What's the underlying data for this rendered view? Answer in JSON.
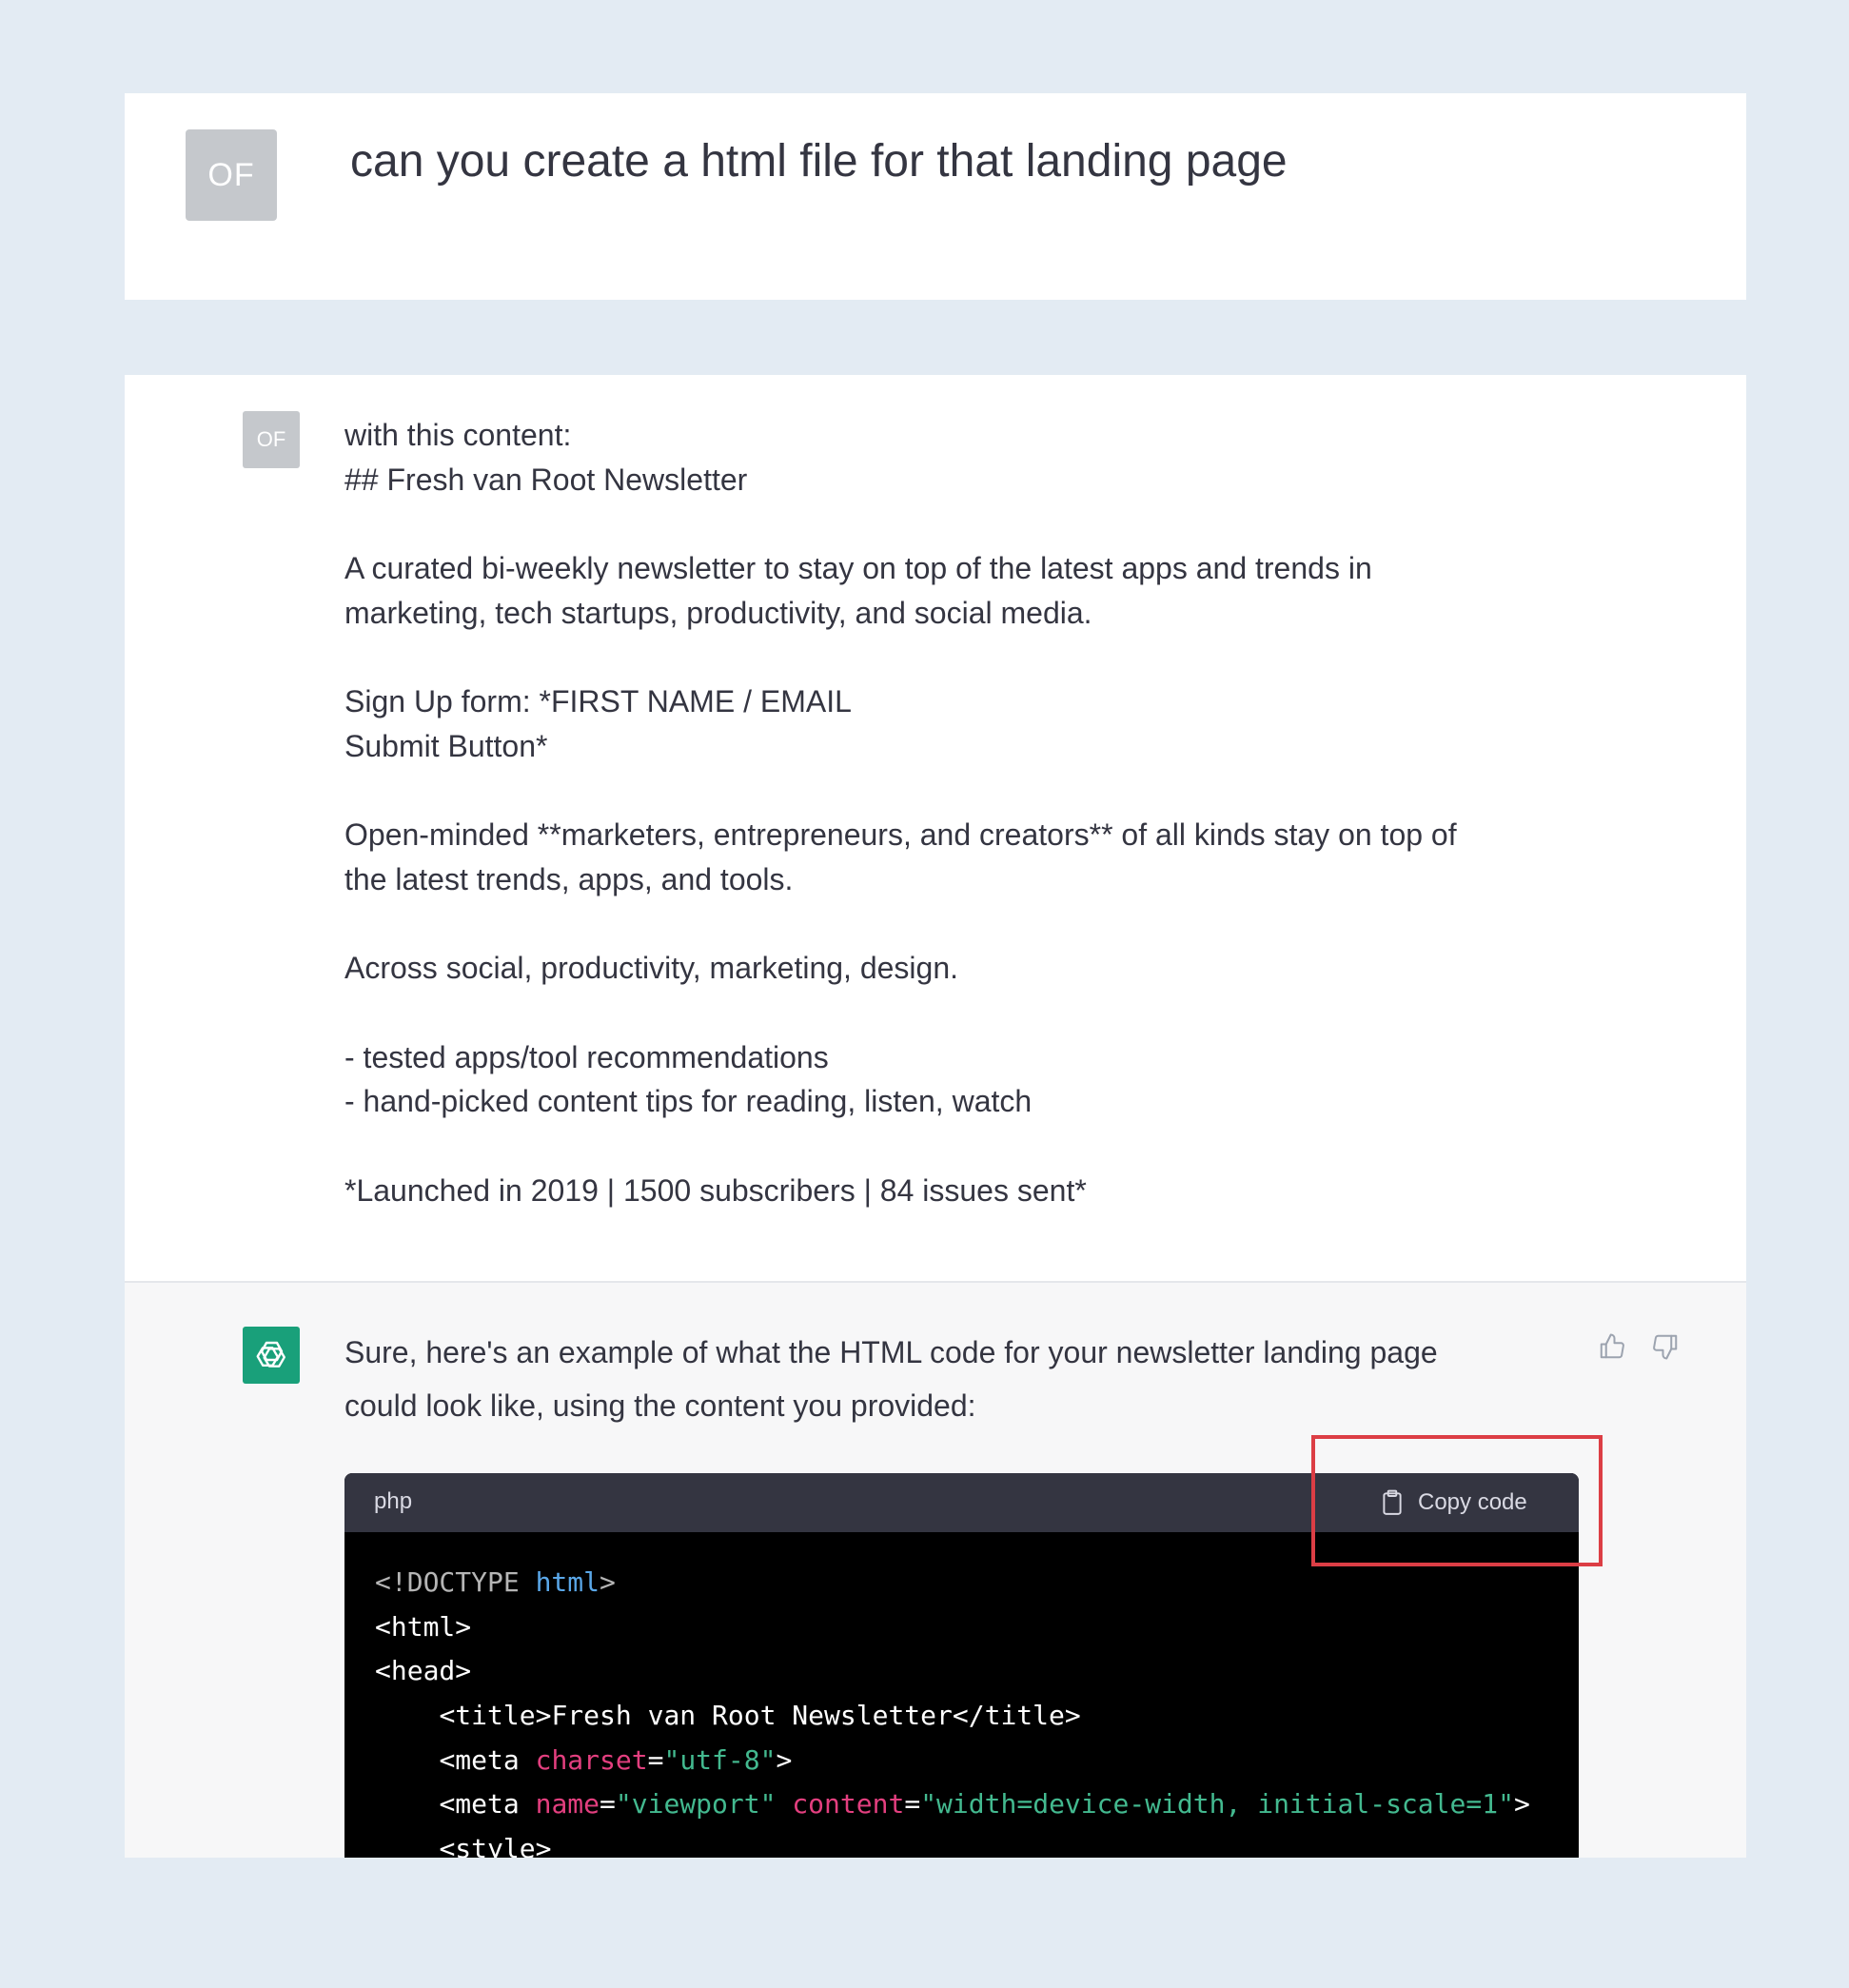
{
  "top_question": {
    "avatar": "OF",
    "text": "can you create a html file for that landing page"
  },
  "user_message": {
    "avatar": "OF",
    "lines": [
      "with this content:",
      "## Fresh van Root Newsletter",
      "",
      "A curated bi-weekly newsletter to stay on top of the latest apps and trends in",
      "marketing, tech startups, productivity, and social media.",
      "",
      "Sign Up form: *FIRST NAME / EMAIL",
      "Submit Button*",
      "",
      "Open-minded **marketers, entrepreneurs, and creators** of all kinds stay on top of",
      "the latest trends, apps, and tools.",
      "",
      "Across social, productivity, marketing, design.",
      "",
      "- tested apps/tool recommendations",
      "- hand-picked content tips for reading, listen, watch",
      "",
      "*Launched in 2019 | 1500 subscribers | 84 issues sent*"
    ]
  },
  "assistant_message": {
    "avatar_icon": "openai-logo-icon",
    "intro_line_1": "Sure, here's an example of what the HTML code for your newsletter landing page",
    "intro_line_2": "could look like, using the content you provided:",
    "feedback_icons": [
      "thumbs-up-icon",
      "thumbs-down-icon"
    ],
    "code_block": {
      "language": "php",
      "copy_label": "Copy code",
      "copy_icon": "clipboard-icon",
      "lines": [
        {
          "indent": "",
          "tokens": [
            [
              "doctype",
              "<!DOCTYPE "
            ],
            [
              "kw",
              "html"
            ],
            [
              "doctype",
              ">"
            ]
          ]
        },
        {
          "indent": "",
          "tokens": [
            [
              "punct",
              "<html>"
            ]
          ]
        },
        {
          "indent": "",
          "tokens": [
            [
              "punct",
              "<head>"
            ]
          ]
        },
        {
          "indent": "    ",
          "tokens": [
            [
              "punct",
              "<title>Fresh van Root Newsletter</title>"
            ]
          ]
        },
        {
          "indent": "    ",
          "tokens": [
            [
              "punct",
              "<meta "
            ],
            [
              "attr",
              "charset"
            ],
            [
              "punct",
              "="
            ],
            [
              "str",
              "\"utf-8\""
            ],
            [
              "punct",
              ">"
            ]
          ]
        },
        {
          "indent": "    ",
          "tokens": [
            [
              "punct",
              "<meta "
            ],
            [
              "attr",
              "name"
            ],
            [
              "punct",
              "="
            ],
            [
              "str",
              "\"viewport\""
            ],
            [
              "punct",
              " "
            ],
            [
              "attr",
              "content"
            ],
            [
              "punct",
              "="
            ],
            [
              "str",
              "\"width=device-width, initial-scale=1\""
            ],
            [
              "punct",
              ">"
            ]
          ]
        },
        {
          "indent": "    ",
          "tokens": [
            [
              "punct",
              "<style>"
            ]
          ]
        }
      ]
    }
  },
  "colors": {
    "page_background": "#e3ebf3",
    "avatar_gray": "#c5c8cc",
    "assistant_bg": "#f7f7f8",
    "gpt_green": "#19a07a",
    "code_header": "#343541",
    "highlight_red": "#dc3e45"
  }
}
